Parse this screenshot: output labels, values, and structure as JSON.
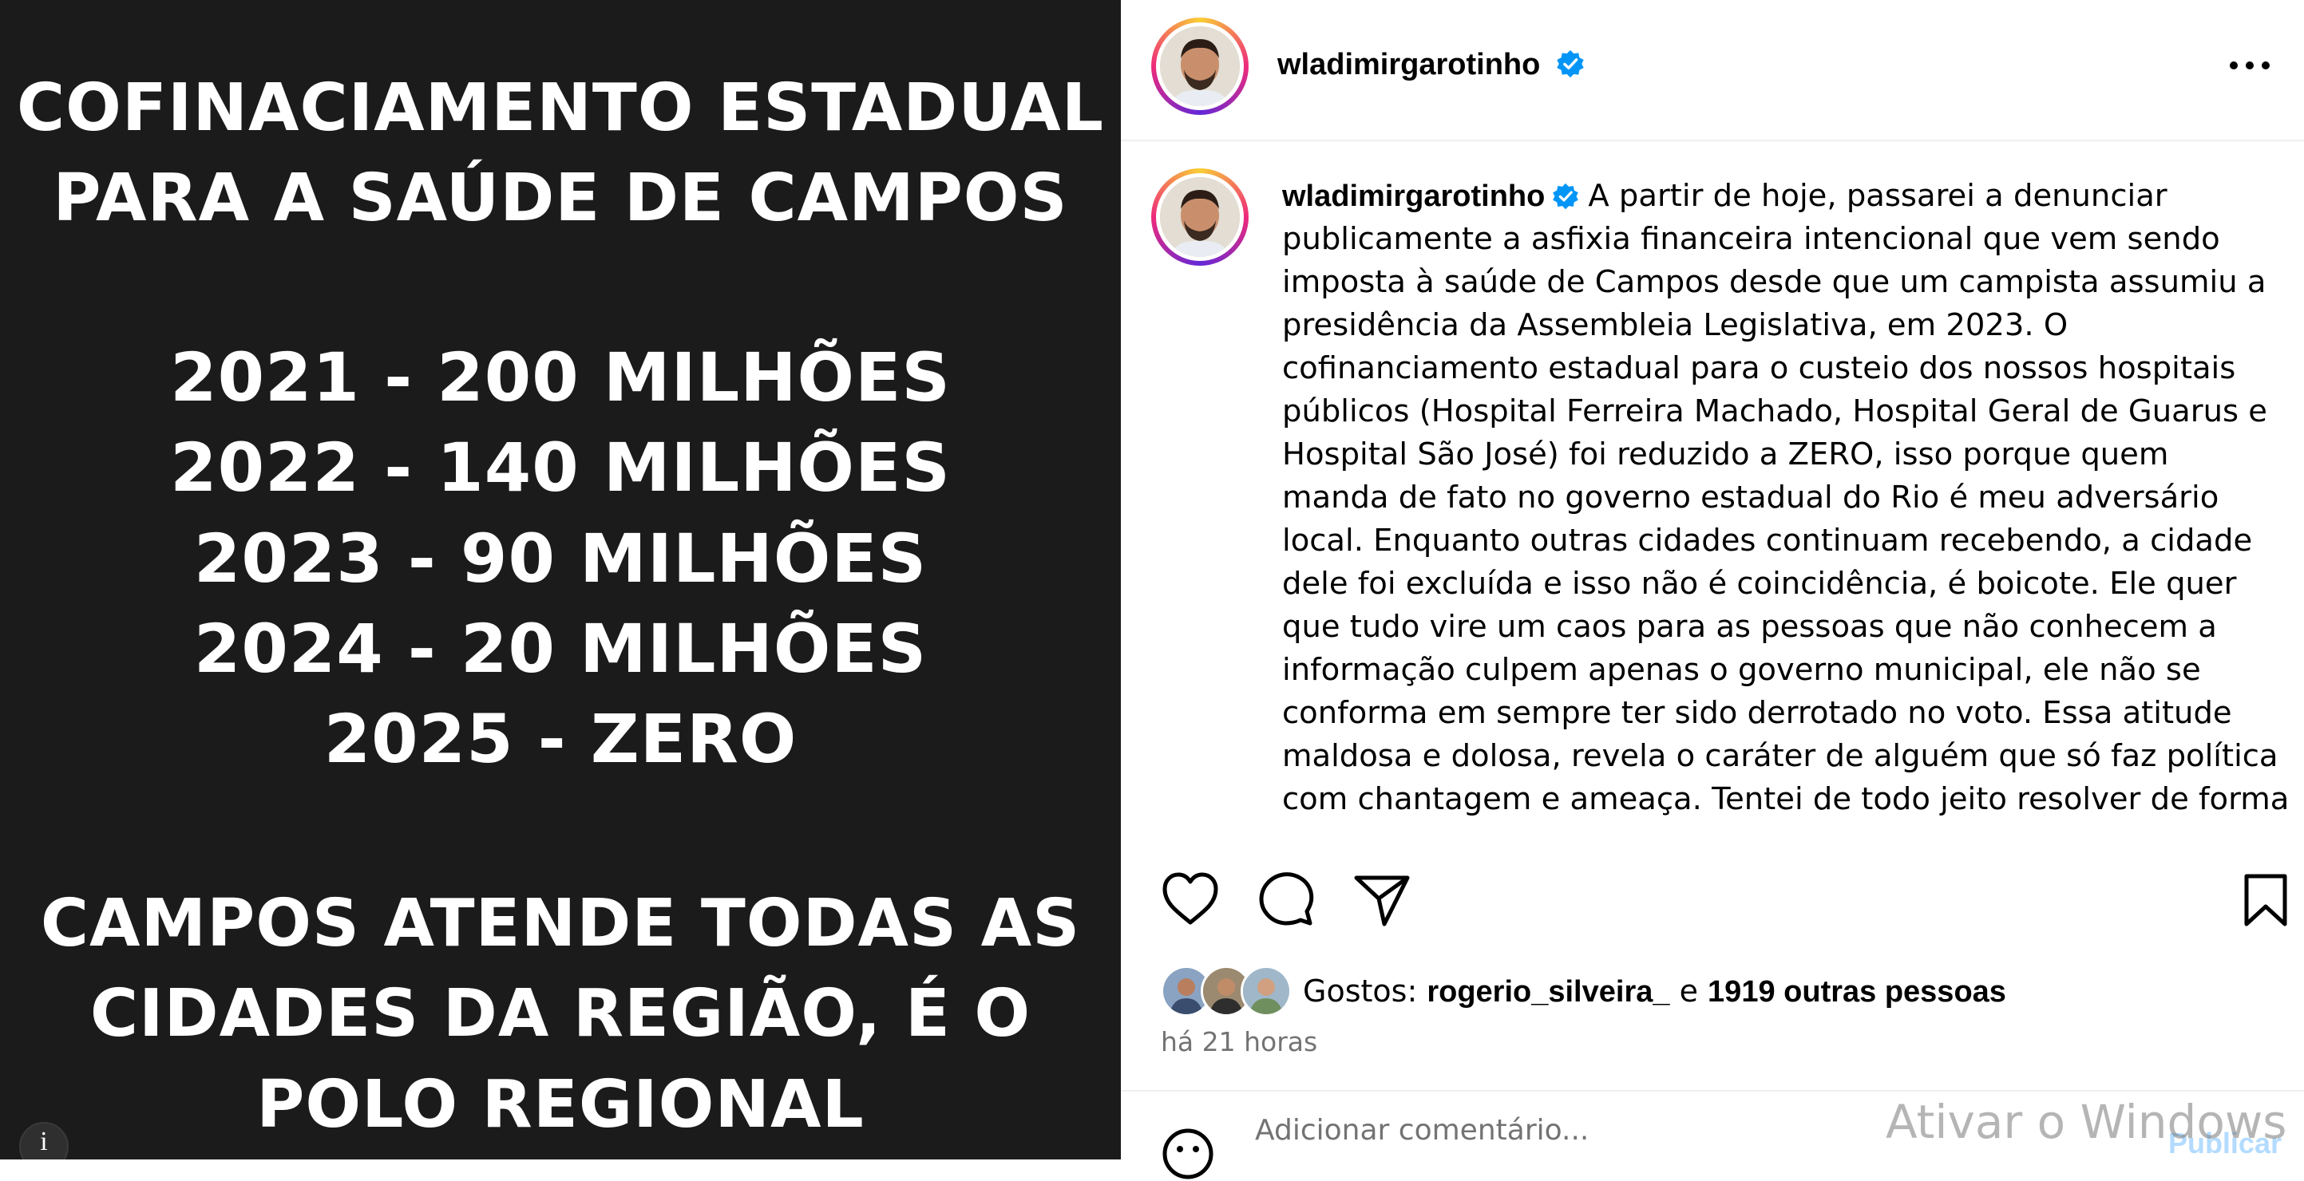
{
  "image_poster": {
    "title_lines": [
      "COFINACIAMENTO ESTADUAL",
      "PARA A SAÚDE DE CAMPOS"
    ],
    "year_lines": [
      "2021  - 200 MILHÕES",
      "2022 - 140 MILHÕES",
      "2023 - 90 MILHÕES",
      "2024 - 20 MILHÕES",
      "2025 - ZERO"
    ],
    "footer_lines": [
      "CAMPOS ATENDE TODAS AS",
      "CIDADES DA REGIÃO, É O",
      "POLO REGIONAL"
    ]
  },
  "header": {
    "username": "wladimirgarotinho",
    "more_label": "···"
  },
  "caption": {
    "username": "wladimirgarotinho",
    "lines": [
      "A partir de hoje, passarei a denunciar",
      "publicamente a asfixia financeira intencional que vem sendo",
      "imposta à saúde de Campos desde que um campista assumiu a",
      "presidência da Assembleia Legislativa, em 2023. O",
      "cofinanciamento estadual para o custeio dos nossos hospitais",
      "públicos (Hospital Ferreira Machado, Hospital Geral de Guarus e",
      "Hospital São José) foi reduzido a ZERO, isso porque quem",
      "manda de fato no governo estadual do Rio é meu adversário",
      "local. Enquanto outras cidades continuam recebendo, a cidade",
      "dele foi excluída e isso não é coincidência, é boicote. Ele quer",
      "que tudo vire um caos para as pessoas que não conhecem a",
      "informação culpem apenas o governo municipal, ele não se",
      "conforma em sempre ter sido derrotado no voto. Essa atitude",
      "maldosa e dolosa, revela o caráter de alguém que só faz política",
      "com chantagem e ameaça. Tentei de todo jeito resolver de forma"
    ]
  },
  "likes": {
    "prefix": "Gostos: ",
    "first_user": "rogerio_silveira_",
    "connector": " e ",
    "others": "1919 outras pessoas"
  },
  "timestamp": "há 21 horas",
  "comment": {
    "placeholder": "Adicionar comentário...",
    "publish_label": "Publicar"
  },
  "watermark": "Ativar o Windows",
  "colors": {
    "panel_bg": "#1b1b1b",
    "verified_blue": "#0095f6",
    "muted_text": "#737373"
  },
  "icons": [
    "info-icon",
    "more-options-icon",
    "verified-badge-icon",
    "heart-icon",
    "comment-icon",
    "share-icon",
    "bookmark-icon",
    "emoji-icon"
  ]
}
